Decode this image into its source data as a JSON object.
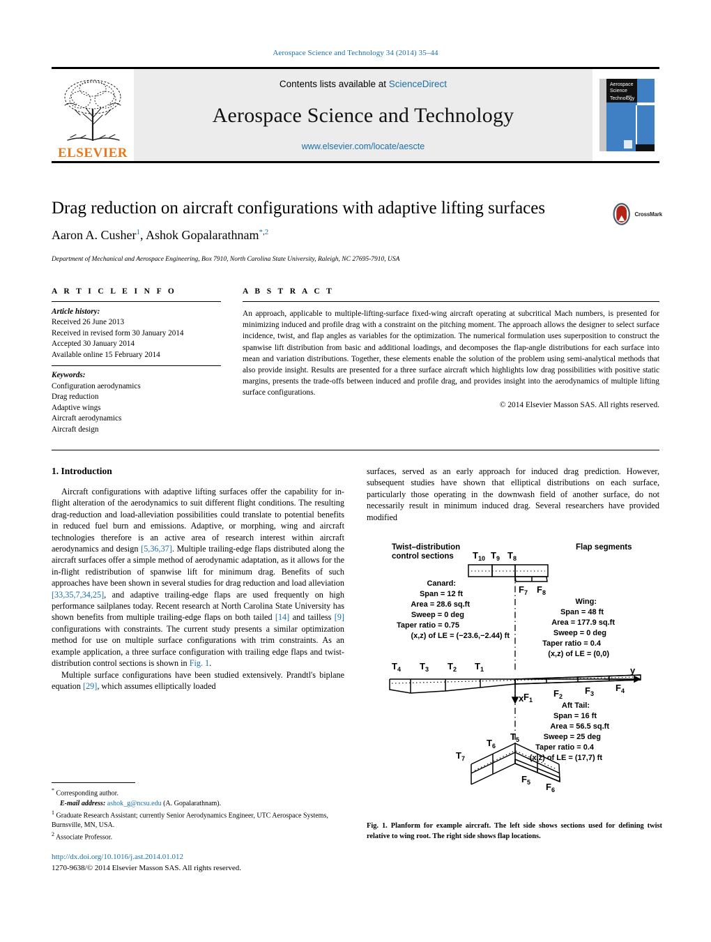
{
  "running_head": "Aerospace Science and Technology 34 (2014) 35–44",
  "masthead": {
    "contents_prefix": "Contents lists available at",
    "sciencedirect": "ScienceDirect",
    "journal_name": "Aerospace Science and Technology",
    "journal_url": "www.elsevier.com/locate/aescte",
    "publisher": "ELSEVIER",
    "cover_lines": [
      "Aerospace",
      "Science",
      "and",
      "Technology"
    ],
    "accent_blue": "#1a6fa8",
    "elsevier_orange": "#E77817",
    "cover_blue": "#3f80c5"
  },
  "article": {
    "title": "Drag reduction on aircraft configurations with adaptive lifting surfaces",
    "crossmark_label": "CrossMark",
    "author_1": "Aaron A. Cusher",
    "author_1_sup": "1",
    "author_2": "Ashok Gopalarathnam",
    "author_2_sup": "2",
    "affiliation": "Department of Mechanical and Aerospace Engineering, Box 7910, North Carolina State University, Raleigh, NC 27695-7910, USA"
  },
  "info": {
    "heading": "A R T I C L E   I N F O",
    "history_label": "Article history:",
    "history": [
      "Received 26 June 2013",
      "Received in revised form 30 January 2014",
      "Accepted 30 January 2014",
      "Available online 15 February 2014"
    ],
    "keywords_label": "Keywords:",
    "keywords": [
      "Configuration aerodynamics",
      "Drag reduction",
      "Adaptive wings",
      "Aircraft aerodynamics",
      "Aircraft design"
    ]
  },
  "abstract": {
    "heading": "A B S T R A C T",
    "text": "An approach, applicable to multiple-lifting-surface fixed-wing aircraft operating at subcritical Mach numbers, is presented for minimizing induced and profile drag with a constraint on the pitching moment. The approach allows the designer to select surface incidence, twist, and flap angles as variables for the optimization. The numerical formulation uses superposition to construct the spanwise lift distribution from basic and additional loadings, and decomposes the flap-angle distributions for each surface into mean and variation distributions. Together, these elements enable the solution of the problem using semi-analytical methods that also provide insight. Results are presented for a three surface aircraft which highlights low drag possibilities with positive static margins, presents the trade-offs between induced and profile drag, and provides insight into the aerodynamics of multiple lifting surface configurations.",
    "copyright": "© 2014 Elsevier Masson SAS. All rights reserved."
  },
  "body": {
    "section_heading": "1. Introduction",
    "left_p1_a": "Aircraft configurations with adaptive lifting surfaces offer the capability for in-flight alteration of the aerodynamics to suit different flight conditions. The resulting drag-reduction and load-alleviation possibilities could translate to potential benefits in reduced fuel burn and emissions. Adaptive, or morphing, wing and aircraft technologies therefore is an active area of research interest within aircraft aerodynamics and design ",
    "cite_1": "[5,36,37]",
    "left_p1_b": ". Multiple trailing-edge flaps distributed along the aircraft surfaces offer a simple method of aerodynamic adaptation, as it allows for the in-flight redistribution of spanwise lift for minimum drag. Benefits of such approaches have been shown in several studies for drag reduction and load alleviation ",
    "cite_2": "[33,35,7,34,25]",
    "left_p1_c": ", and adaptive trailing-edge flaps are used frequently on high performance sailplanes today. Recent research at North Carolina State University has shown benefits from multiple trailing-edge flaps on both tailed ",
    "cite_3": "[14]",
    "left_p1_d": " and tailless ",
    "cite_4": "[9]",
    "left_p1_e": " configurations with constraints. The current study presents a similar optimization method for use on multiple surface configurations with trim constraints. As an example application, a three surface configuration with trailing edge flaps and twist-distribution control sections is shown in ",
    "fig_link": "Fig. 1",
    "left_p1_f": ".",
    "left_p2_a": "Multiple surface configurations have been studied extensively. Prandtl's biplane equation ",
    "cite_5": "[29]",
    "left_p2_b": ", which assumes elliptically loaded",
    "right_p1": "surfaces, served as an early approach for induced drag prediction. However, subsequent studies have shown that elliptical distributions on each surface, particularly those operating in the downwash field of another surface, do not necessarily result in minimum induced drag. Several researchers have provided modified"
  },
  "footnotes": {
    "corresponding_marker": "*",
    "corresponding": "Corresponding author.",
    "email_label": "E-mail address:",
    "email": "ashok_g@ncsu.edu",
    "email_suffix": "(A. Gopalarathnam).",
    "fn1_marker": "1",
    "fn1": "Graduate Research Assistant; currently Senior Aerodynamics Engineer, UTC Aerospace Systems, Burnsville, MN, USA.",
    "fn2_marker": "2",
    "fn2": "Associate Professor."
  },
  "doi_block": {
    "doi": "http://dx.doi.org/10.1016/j.ast.2014.01.012",
    "issn_line": "1270-9638/© 2014 Elsevier Masson SAS. All rights reserved."
  },
  "figure": {
    "caption": "Fig. 1. Planform for example aircraft. The left side shows sections used for defining twist relative to wing root. The right side shows flap locations.",
    "header_left_line1": "Twist–distribution",
    "header_left_line2": "control sections",
    "header_right": "Flap segments",
    "axis_y": "y",
    "axis_x": "x",
    "canard_twist_labels": [
      "T",
      "T",
      "T"
    ],
    "canard_twist_subs": [
      "10",
      "9",
      "8"
    ],
    "canard_flap_labels": [
      "F",
      "F"
    ],
    "canard_flap_subs": [
      "7",
      "8"
    ],
    "wing_twist_subs": [
      "4",
      "3",
      "2",
      "1"
    ],
    "wing_flap_subs": [
      "1",
      "2",
      "3",
      "4"
    ],
    "tail_twist_subs": [
      "7",
      "6",
      "5"
    ],
    "tail_flap_subs": [
      "5",
      "6"
    ],
    "canard_spec": {
      "name": "Canard:",
      "lines": [
        "Span = 12 ft",
        "Area = 28.6 sq.ft",
        "Sweep = 0 deg",
        "Taper ratio = 0.75",
        "(x,z) of LE = (−23.6,−2.44) ft"
      ]
    },
    "wing_spec": {
      "name": "Wing:",
      "lines": [
        "Span = 48 ft",
        "Area = 177.9 sq.ft",
        "Sweep = 0 deg",
        "Taper ratio = 0.4",
        "(x,z) of LE = (0,0)"
      ]
    },
    "tail_spec": {
      "name": "Aft Tail:",
      "lines": [
        "Span = 16 ft",
        "Area = 56.5 sq.ft",
        "Sweep = 25 deg",
        "Taper ratio = 0.4",
        "(x,z) of LE = (17,7) ft"
      ]
    }
  }
}
